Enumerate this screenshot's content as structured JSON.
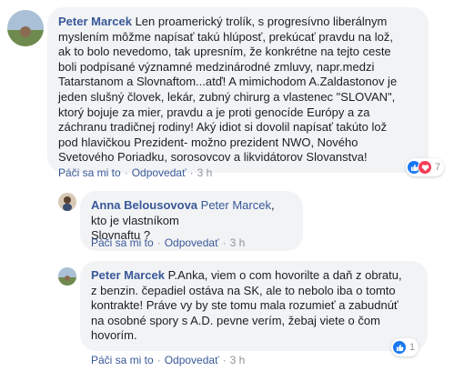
{
  "comments": [
    {
      "author": "Peter Marcek",
      "text": " Len proamerický trolík, s progresívno liberálnym\nmyslením môžme napísať takú hlúposť, prekúcať pravdu na lož,\nak to bolo nevedomo, tak upresním, že konkrétne na tejto ceste\nboli podpísané významné medzinárodné zmluvy, napr.medzi\nTatarstanom a Slovnaftom...atď! A mimichodom A.Zaldastonov je\njeden slušný človek, lekár, zubný chirurg a vlastenec \"SLOVAN\",\nktorý bojuje za mier, pravdu a je proti genocíde Európy a za\nzáchranu tradičnej rodiny! Aký idiot si dovolil napísať takúto lož\npod hlavičkou Prezident- možno prezident NWO, Nového\nSvetového Poriadku, sorosovcov a likvidátorov Slovanstva!",
      "like": "Páči sa mi to",
      "reply": "Odpovedať",
      "time": "3 h",
      "reaction_count": "7"
    },
    {
      "author": "Anna Belousovova",
      "mention": "Peter Marcek",
      "text": ", kto je vlastníkom\nSlovnaftu ?",
      "like": "Páči sa mi to",
      "reply": "Odpovedať",
      "time": "3 h"
    },
    {
      "author": "Peter Marcek",
      "text": " P.Anka, viem o com hovorilte a daň z obratu,\nz benzin. čepadiel ostáva na SK, ale to nebolo iba o tomto\nkontrakte! Práve vy by ste tomu mala rozumieť a zabudnúť\nna osobné spory s A.D. pevne verím, žebaj viete o čom\nhovorím.",
      "like": "Páči sa mi to",
      "reply": "Odpovedať",
      "time": "3 h",
      "reaction_count": "1"
    }
  ],
  "colors": {
    "link": "#385898",
    "bubble": "#f2f3f5",
    "like": "#1877f2",
    "love": "#f33e58"
  }
}
